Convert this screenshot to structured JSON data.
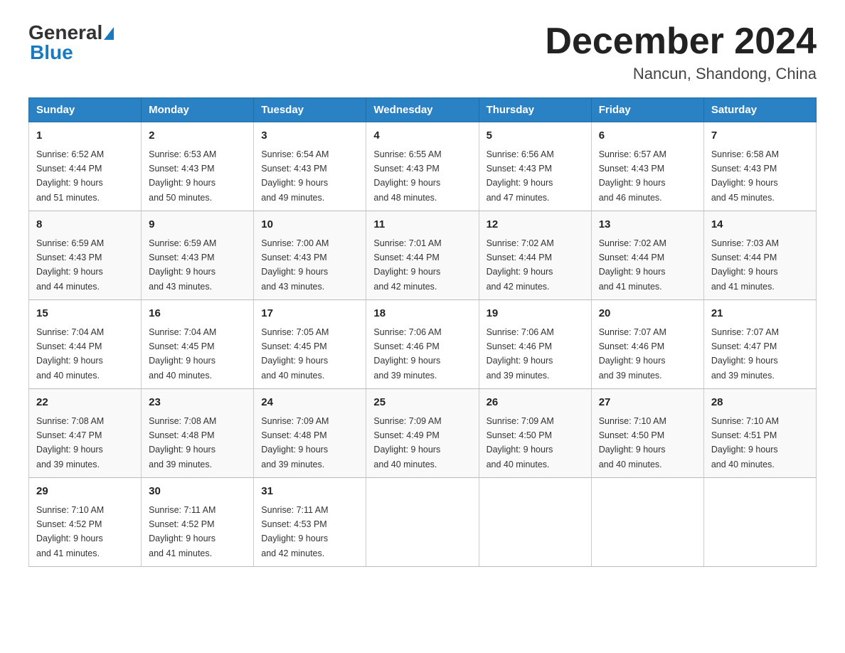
{
  "header": {
    "logo_general": "General",
    "logo_blue": "Blue",
    "month_year": "December 2024",
    "location": "Nancun, Shandong, China"
  },
  "days_of_week": [
    "Sunday",
    "Monday",
    "Tuesday",
    "Wednesday",
    "Thursday",
    "Friday",
    "Saturday"
  ],
  "weeks": [
    [
      {
        "day": "1",
        "sunrise": "6:52 AM",
        "sunset": "4:44 PM",
        "daylight": "9 hours and 51 minutes."
      },
      {
        "day": "2",
        "sunrise": "6:53 AM",
        "sunset": "4:43 PM",
        "daylight": "9 hours and 50 minutes."
      },
      {
        "day": "3",
        "sunrise": "6:54 AM",
        "sunset": "4:43 PM",
        "daylight": "9 hours and 49 minutes."
      },
      {
        "day": "4",
        "sunrise": "6:55 AM",
        "sunset": "4:43 PM",
        "daylight": "9 hours and 48 minutes."
      },
      {
        "day": "5",
        "sunrise": "6:56 AM",
        "sunset": "4:43 PM",
        "daylight": "9 hours and 47 minutes."
      },
      {
        "day": "6",
        "sunrise": "6:57 AM",
        "sunset": "4:43 PM",
        "daylight": "9 hours and 46 minutes."
      },
      {
        "day": "7",
        "sunrise": "6:58 AM",
        "sunset": "4:43 PM",
        "daylight": "9 hours and 45 minutes."
      }
    ],
    [
      {
        "day": "8",
        "sunrise": "6:59 AM",
        "sunset": "4:43 PM",
        "daylight": "9 hours and 44 minutes."
      },
      {
        "day": "9",
        "sunrise": "6:59 AM",
        "sunset": "4:43 PM",
        "daylight": "9 hours and 43 minutes."
      },
      {
        "day": "10",
        "sunrise": "7:00 AM",
        "sunset": "4:43 PM",
        "daylight": "9 hours and 43 minutes."
      },
      {
        "day": "11",
        "sunrise": "7:01 AM",
        "sunset": "4:44 PM",
        "daylight": "9 hours and 42 minutes."
      },
      {
        "day": "12",
        "sunrise": "7:02 AM",
        "sunset": "4:44 PM",
        "daylight": "9 hours and 42 minutes."
      },
      {
        "day": "13",
        "sunrise": "7:02 AM",
        "sunset": "4:44 PM",
        "daylight": "9 hours and 41 minutes."
      },
      {
        "day": "14",
        "sunrise": "7:03 AM",
        "sunset": "4:44 PM",
        "daylight": "9 hours and 41 minutes."
      }
    ],
    [
      {
        "day": "15",
        "sunrise": "7:04 AM",
        "sunset": "4:44 PM",
        "daylight": "9 hours and 40 minutes."
      },
      {
        "day": "16",
        "sunrise": "7:04 AM",
        "sunset": "4:45 PM",
        "daylight": "9 hours and 40 minutes."
      },
      {
        "day": "17",
        "sunrise": "7:05 AM",
        "sunset": "4:45 PM",
        "daylight": "9 hours and 40 minutes."
      },
      {
        "day": "18",
        "sunrise": "7:06 AM",
        "sunset": "4:46 PM",
        "daylight": "9 hours and 39 minutes."
      },
      {
        "day": "19",
        "sunrise": "7:06 AM",
        "sunset": "4:46 PM",
        "daylight": "9 hours and 39 minutes."
      },
      {
        "day": "20",
        "sunrise": "7:07 AM",
        "sunset": "4:46 PM",
        "daylight": "9 hours and 39 minutes."
      },
      {
        "day": "21",
        "sunrise": "7:07 AM",
        "sunset": "4:47 PM",
        "daylight": "9 hours and 39 minutes."
      }
    ],
    [
      {
        "day": "22",
        "sunrise": "7:08 AM",
        "sunset": "4:47 PM",
        "daylight": "9 hours and 39 minutes."
      },
      {
        "day": "23",
        "sunrise": "7:08 AM",
        "sunset": "4:48 PM",
        "daylight": "9 hours and 39 minutes."
      },
      {
        "day": "24",
        "sunrise": "7:09 AM",
        "sunset": "4:48 PM",
        "daylight": "9 hours and 39 minutes."
      },
      {
        "day": "25",
        "sunrise": "7:09 AM",
        "sunset": "4:49 PM",
        "daylight": "9 hours and 40 minutes."
      },
      {
        "day": "26",
        "sunrise": "7:09 AM",
        "sunset": "4:50 PM",
        "daylight": "9 hours and 40 minutes."
      },
      {
        "day": "27",
        "sunrise": "7:10 AM",
        "sunset": "4:50 PM",
        "daylight": "9 hours and 40 minutes."
      },
      {
        "day": "28",
        "sunrise": "7:10 AM",
        "sunset": "4:51 PM",
        "daylight": "9 hours and 40 minutes."
      }
    ],
    [
      {
        "day": "29",
        "sunrise": "7:10 AM",
        "sunset": "4:52 PM",
        "daylight": "9 hours and 41 minutes."
      },
      {
        "day": "30",
        "sunrise": "7:11 AM",
        "sunset": "4:52 PM",
        "daylight": "9 hours and 41 minutes."
      },
      {
        "day": "31",
        "sunrise": "7:11 AM",
        "sunset": "4:53 PM",
        "daylight": "9 hours and 42 minutes."
      },
      null,
      null,
      null,
      null
    ]
  ],
  "labels": {
    "sunrise": "Sunrise:",
    "sunset": "Sunset:",
    "daylight": "Daylight:"
  }
}
